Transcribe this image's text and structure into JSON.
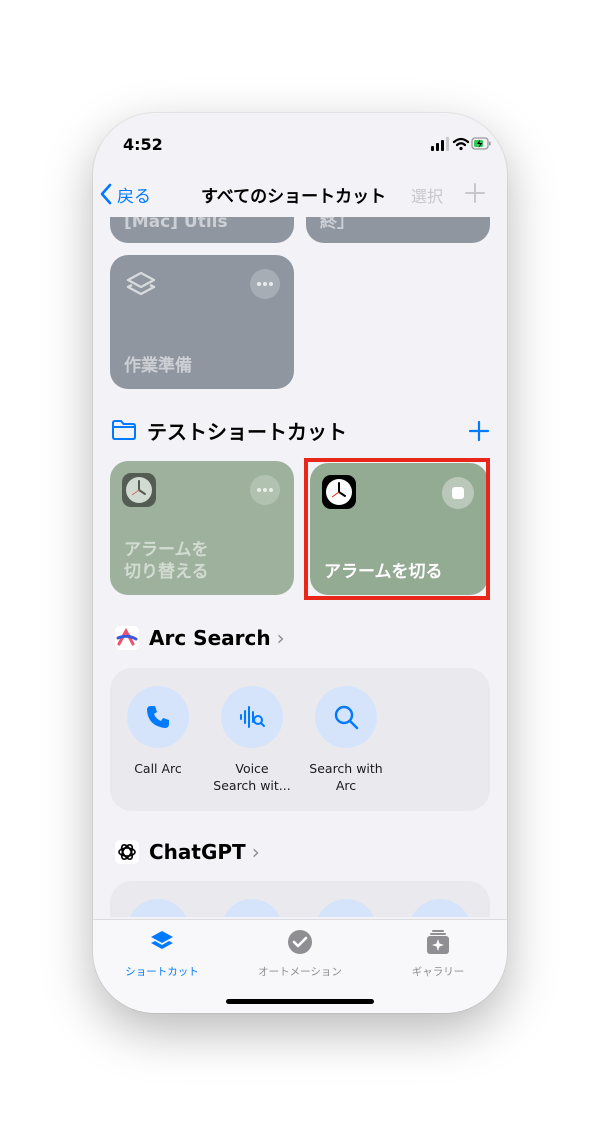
{
  "status": {
    "time": "4:52"
  },
  "nav": {
    "back_label": "戻る",
    "title": "すべてのショートカット",
    "select_label": "選択"
  },
  "partial_cards": {
    "left": "[Mac] Utils",
    "right": "終」"
  },
  "work_card": {
    "label": "作業準備"
  },
  "section": {
    "title": "テストショートカット"
  },
  "test_cards": [
    {
      "label_line1": "アラームを",
      "label_line2": "切り替える"
    },
    {
      "label": "アラームを切る",
      "running": true
    }
  ],
  "arc": {
    "app_name": "Arc Search",
    "actions": [
      {
        "label_line1": "Call Arc",
        "label_line2": "",
        "icon": "phone-icon"
      },
      {
        "label_line1": "Voice",
        "label_line2": "Search wit...",
        "icon": "voice-search-icon"
      },
      {
        "label_line1": "Search with",
        "label_line2": "Arc",
        "icon": "search-icon"
      }
    ]
  },
  "chatgpt": {
    "app_name": "ChatGPT"
  },
  "tabbar": {
    "tabs": [
      {
        "label": "ショートカット",
        "active": true,
        "icon": "shortcuts-icon"
      },
      {
        "label": "オートメーション",
        "active": false,
        "icon": "automation-icon"
      },
      {
        "label": "ギャラリー",
        "active": false,
        "icon": "gallery-icon"
      }
    ]
  },
  "colors": {
    "accent": "#007aff",
    "highlight": "#e8271a",
    "card_gray": "#8f969f",
    "card_green": "#94ab93"
  }
}
